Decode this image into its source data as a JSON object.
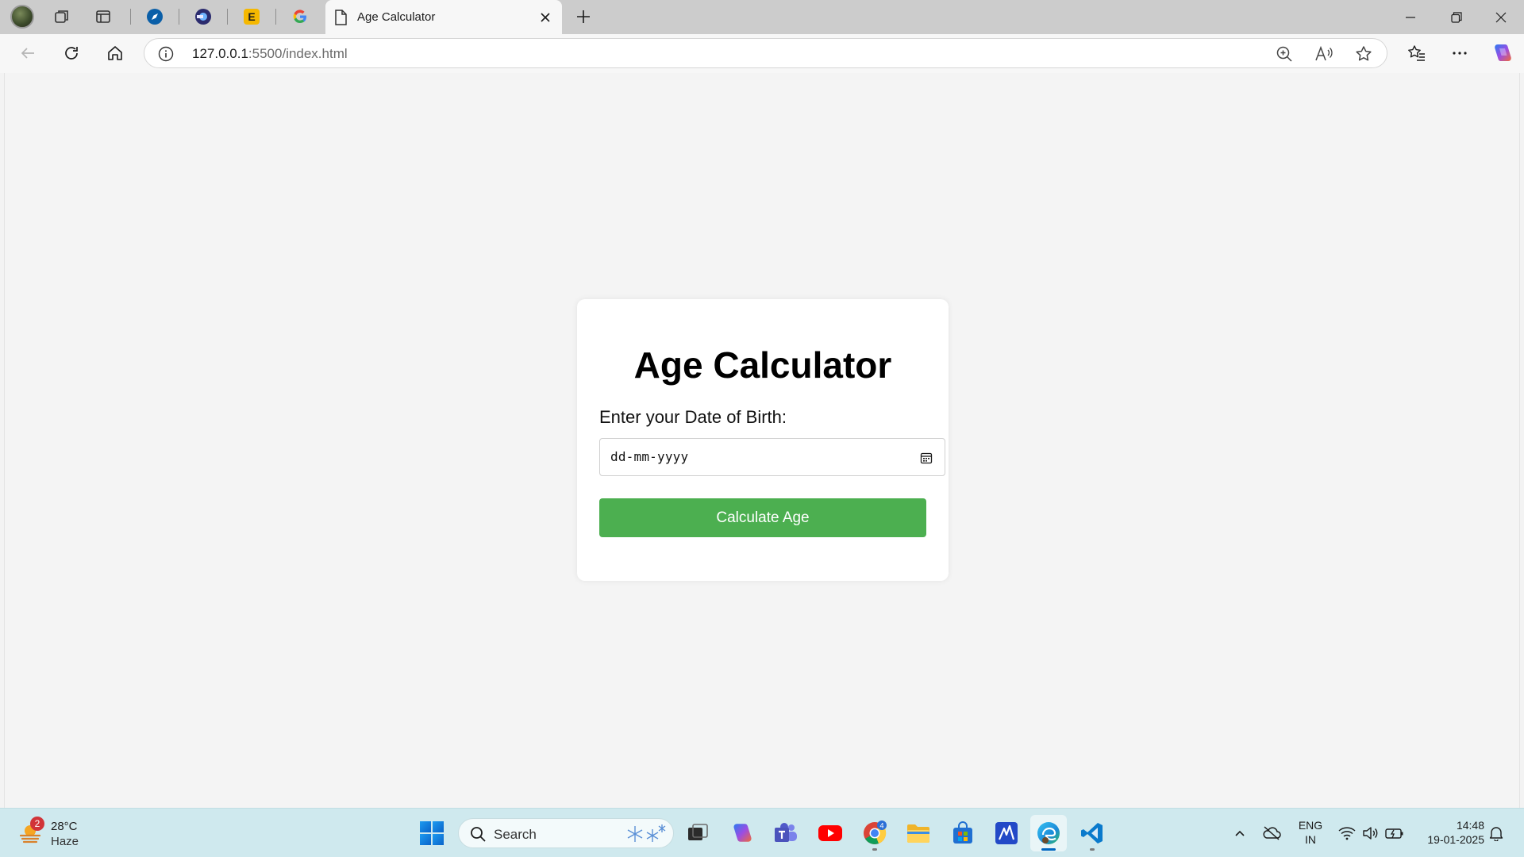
{
  "browser": {
    "active_tab_title": "Age Calculator",
    "url_host": "127.0.0.1",
    "url_rest": ":5500/index.html",
    "pinned_tab_icons": [
      "compass-icon",
      "browser-extension-icon",
      "e-letter-icon",
      "google-icon"
    ]
  },
  "page": {
    "heading": "Age Calculator",
    "dob_label": "Enter your Date of Birth:",
    "date_placeholder": "dd-mm-yyyy",
    "calculate_button": "Calculate Age"
  },
  "taskbar": {
    "weather_badge": "2",
    "temperature": "28°C",
    "condition": "Haze",
    "search_label": "Search",
    "chrome_badge": "4",
    "language_line1": "ENG",
    "language_line2": "IN",
    "time": "14:48",
    "date": "19-01-2025"
  },
  "colors": {
    "button_green": "#4caf50",
    "page_bg": "#f4f4f4",
    "tabstrip_bg": "#cccccc",
    "taskbar_bg": "#cfe9ee"
  }
}
